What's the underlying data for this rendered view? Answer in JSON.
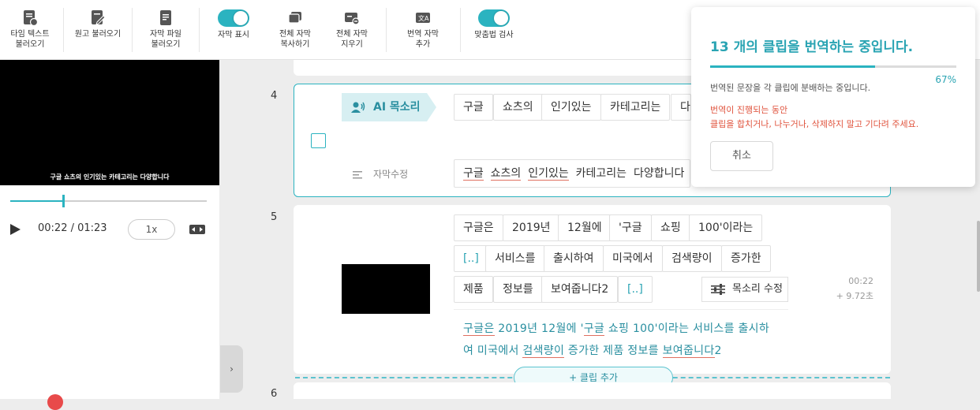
{
  "toolbar": {
    "load_timed_text": "타임 텍스트\n불러오기",
    "load_script": "원고 불러오기",
    "load_subtitle_file": "자막 파일\n불러오기",
    "show_subtitles": "자막 표시",
    "copy_all_subtitles": "전체 자막\n복사하기",
    "clear_all_subtitles": "전체 자막\n지우기",
    "add_translated_subtitles": "번역 자막\n추가",
    "spell_check": "맞춤법 검사",
    "accent": "#2bb3c0"
  },
  "player": {
    "subtitle": "구글 쇼츠의 인기있는 카테고리는 다양합니다",
    "time": "00:22 / 01:23",
    "speed": "1x",
    "progress_fraction": 0.27
  },
  "clip4": {
    "number": "4",
    "ai_voice_label": "AI 목소리",
    "chips": [
      "구글",
      "쇼츠의",
      "인기있는",
      "카테고리는",
      "다"
    ],
    "edit_label": "자막수정",
    "subtitle_words": [
      "구글",
      "쇼츠의",
      "인기있는",
      "카테고리는",
      "다양합니다"
    ]
  },
  "clip5": {
    "number": "5",
    "chips_row1": [
      "구글은",
      "2019년",
      "12월에",
      "'구글",
      "쇼핑",
      "100'이라는"
    ],
    "chips_row2": [
      "[..]",
      "서비스를",
      "출시하여",
      "미국에서",
      "검색량이",
      "증가한"
    ],
    "chips_row3": [
      "제품",
      "정보를",
      "보여줍니다2",
      "[..]"
    ],
    "voice_edit": "목소리 수정",
    "timestamp": "00:22",
    "duration": "+ 9.72초",
    "final_line1": [
      "구글은",
      " 2019년 12월에 '",
      "구글",
      " 쇼핑 100'이라는 서비스를 출시하"
    ],
    "final_line2": [
      "여 미국에서 ",
      "검색량이",
      " 증가한 제품 정보를 ",
      "보여줍니다",
      "2"
    ]
  },
  "add_clip": "+ 클립 추가",
  "clip6": {
    "number": "6"
  },
  "popup": {
    "title": "13 개의 클립을 번역하는 중입니다.",
    "progress_pct": "67%",
    "progress_fraction": 0.67,
    "description": "번역된 문장을 각 클립에 분배하는 중입니다.",
    "warning_line1": "번역이 진행되는 동안",
    "warning_line2": "클립을 합치거나, 나누거나, 삭제하지 말고 기다려 주세요.",
    "cancel": "취소"
  }
}
